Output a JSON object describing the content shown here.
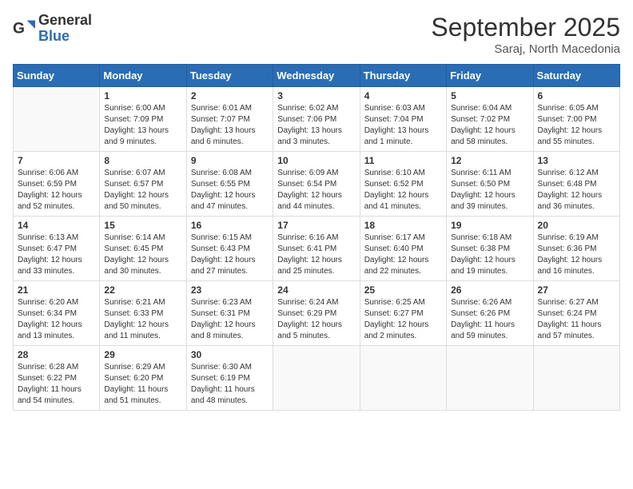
{
  "header": {
    "logo_general": "General",
    "logo_blue": "Blue",
    "month_title": "September 2025",
    "location": "Saraj, North Macedonia"
  },
  "days_of_week": [
    "Sunday",
    "Monday",
    "Tuesday",
    "Wednesday",
    "Thursday",
    "Friday",
    "Saturday"
  ],
  "weeks": [
    [
      {
        "day": "",
        "empty": true
      },
      {
        "day": "1",
        "sunrise": "Sunrise: 6:00 AM",
        "sunset": "Sunset: 7:09 PM",
        "daylight": "Daylight: 13 hours and 9 minutes."
      },
      {
        "day": "2",
        "sunrise": "Sunrise: 6:01 AM",
        "sunset": "Sunset: 7:07 PM",
        "daylight": "Daylight: 13 hours and 6 minutes."
      },
      {
        "day": "3",
        "sunrise": "Sunrise: 6:02 AM",
        "sunset": "Sunset: 7:06 PM",
        "daylight": "Daylight: 13 hours and 3 minutes."
      },
      {
        "day": "4",
        "sunrise": "Sunrise: 6:03 AM",
        "sunset": "Sunset: 7:04 PM",
        "daylight": "Daylight: 13 hours and 1 minute."
      },
      {
        "day": "5",
        "sunrise": "Sunrise: 6:04 AM",
        "sunset": "Sunset: 7:02 PM",
        "daylight": "Daylight: 12 hours and 58 minutes."
      },
      {
        "day": "6",
        "sunrise": "Sunrise: 6:05 AM",
        "sunset": "Sunset: 7:00 PM",
        "daylight": "Daylight: 12 hours and 55 minutes."
      }
    ],
    [
      {
        "day": "7",
        "sunrise": "Sunrise: 6:06 AM",
        "sunset": "Sunset: 6:59 PM",
        "daylight": "Daylight: 12 hours and 52 minutes."
      },
      {
        "day": "8",
        "sunrise": "Sunrise: 6:07 AM",
        "sunset": "Sunset: 6:57 PM",
        "daylight": "Daylight: 12 hours and 50 minutes."
      },
      {
        "day": "9",
        "sunrise": "Sunrise: 6:08 AM",
        "sunset": "Sunset: 6:55 PM",
        "daylight": "Daylight: 12 hours and 47 minutes."
      },
      {
        "day": "10",
        "sunrise": "Sunrise: 6:09 AM",
        "sunset": "Sunset: 6:54 PM",
        "daylight": "Daylight: 12 hours and 44 minutes."
      },
      {
        "day": "11",
        "sunrise": "Sunrise: 6:10 AM",
        "sunset": "Sunset: 6:52 PM",
        "daylight": "Daylight: 12 hours and 41 minutes."
      },
      {
        "day": "12",
        "sunrise": "Sunrise: 6:11 AM",
        "sunset": "Sunset: 6:50 PM",
        "daylight": "Daylight: 12 hours and 39 minutes."
      },
      {
        "day": "13",
        "sunrise": "Sunrise: 6:12 AM",
        "sunset": "Sunset: 6:48 PM",
        "daylight": "Daylight: 12 hours and 36 minutes."
      }
    ],
    [
      {
        "day": "14",
        "sunrise": "Sunrise: 6:13 AM",
        "sunset": "Sunset: 6:47 PM",
        "daylight": "Daylight: 12 hours and 33 minutes."
      },
      {
        "day": "15",
        "sunrise": "Sunrise: 6:14 AM",
        "sunset": "Sunset: 6:45 PM",
        "daylight": "Daylight: 12 hours and 30 minutes."
      },
      {
        "day": "16",
        "sunrise": "Sunrise: 6:15 AM",
        "sunset": "Sunset: 6:43 PM",
        "daylight": "Daylight: 12 hours and 27 minutes."
      },
      {
        "day": "17",
        "sunrise": "Sunrise: 6:16 AM",
        "sunset": "Sunset: 6:41 PM",
        "daylight": "Daylight: 12 hours and 25 minutes."
      },
      {
        "day": "18",
        "sunrise": "Sunrise: 6:17 AM",
        "sunset": "Sunset: 6:40 PM",
        "daylight": "Daylight: 12 hours and 22 minutes."
      },
      {
        "day": "19",
        "sunrise": "Sunrise: 6:18 AM",
        "sunset": "Sunset: 6:38 PM",
        "daylight": "Daylight: 12 hours and 19 minutes."
      },
      {
        "day": "20",
        "sunrise": "Sunrise: 6:19 AM",
        "sunset": "Sunset: 6:36 PM",
        "daylight": "Daylight: 12 hours and 16 minutes."
      }
    ],
    [
      {
        "day": "21",
        "sunrise": "Sunrise: 6:20 AM",
        "sunset": "Sunset: 6:34 PM",
        "daylight": "Daylight: 12 hours and 13 minutes."
      },
      {
        "day": "22",
        "sunrise": "Sunrise: 6:21 AM",
        "sunset": "Sunset: 6:33 PM",
        "daylight": "Daylight: 12 hours and 11 minutes."
      },
      {
        "day": "23",
        "sunrise": "Sunrise: 6:23 AM",
        "sunset": "Sunset: 6:31 PM",
        "daylight": "Daylight: 12 hours and 8 minutes."
      },
      {
        "day": "24",
        "sunrise": "Sunrise: 6:24 AM",
        "sunset": "Sunset: 6:29 PM",
        "daylight": "Daylight: 12 hours and 5 minutes."
      },
      {
        "day": "25",
        "sunrise": "Sunrise: 6:25 AM",
        "sunset": "Sunset: 6:27 PM",
        "daylight": "Daylight: 12 hours and 2 minutes."
      },
      {
        "day": "26",
        "sunrise": "Sunrise: 6:26 AM",
        "sunset": "Sunset: 6:26 PM",
        "daylight": "Daylight: 11 hours and 59 minutes."
      },
      {
        "day": "27",
        "sunrise": "Sunrise: 6:27 AM",
        "sunset": "Sunset: 6:24 PM",
        "daylight": "Daylight: 11 hours and 57 minutes."
      }
    ],
    [
      {
        "day": "28",
        "sunrise": "Sunrise: 6:28 AM",
        "sunset": "Sunset: 6:22 PM",
        "daylight": "Daylight: 11 hours and 54 minutes."
      },
      {
        "day": "29",
        "sunrise": "Sunrise: 6:29 AM",
        "sunset": "Sunset: 6:20 PM",
        "daylight": "Daylight: 11 hours and 51 minutes."
      },
      {
        "day": "30",
        "sunrise": "Sunrise: 6:30 AM",
        "sunset": "Sunset: 6:19 PM",
        "daylight": "Daylight: 11 hours and 48 minutes."
      },
      {
        "day": "",
        "empty": true
      },
      {
        "day": "",
        "empty": true
      },
      {
        "day": "",
        "empty": true
      },
      {
        "day": "",
        "empty": true
      }
    ]
  ]
}
